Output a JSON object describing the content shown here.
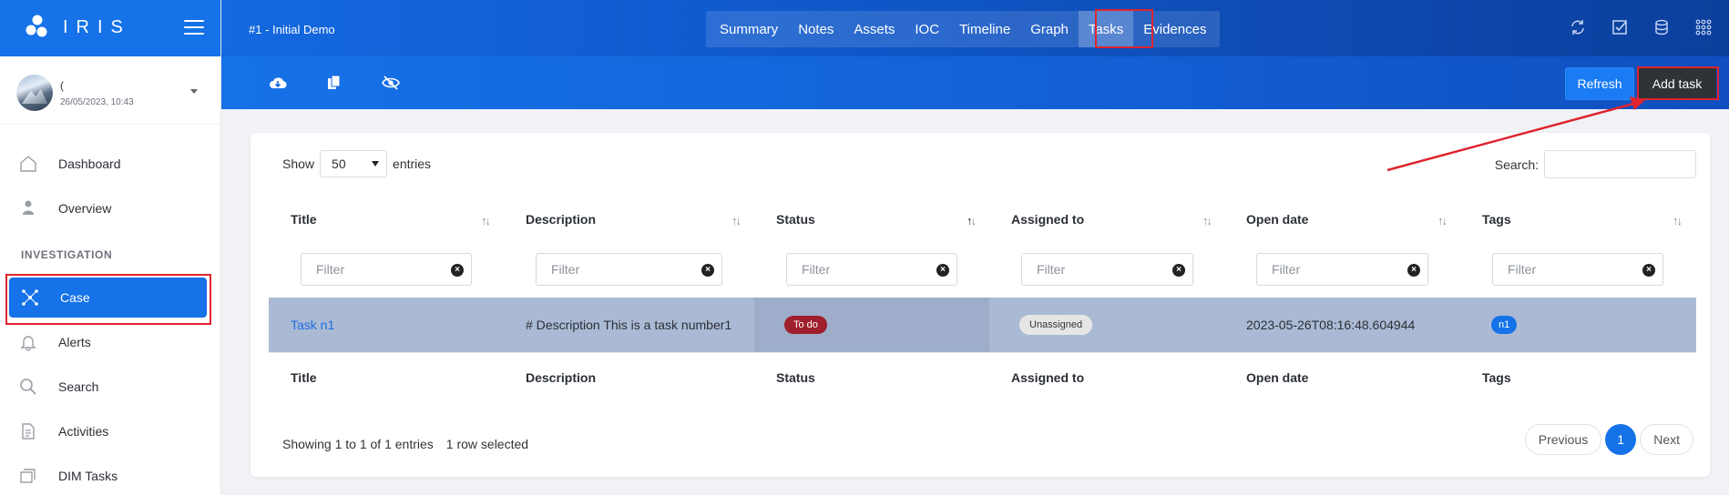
{
  "app": {
    "logo_text": "IRIS"
  },
  "user": {
    "name": "(",
    "date": "26/05/2023, 10:43"
  },
  "sidebar": {
    "section_label": "INVESTIGATION",
    "items": [
      {
        "label": "Dashboard",
        "icon": "home-icon"
      },
      {
        "label": "Overview",
        "icon": "user-pin-icon"
      },
      {
        "label": "Case",
        "icon": "network-icon"
      },
      {
        "label": "Alerts",
        "icon": "bell-icon"
      },
      {
        "label": "Search",
        "icon": "search-icon"
      },
      {
        "label": "Activities",
        "icon": "document-icon"
      },
      {
        "label": "DIM Tasks",
        "icon": "stack-icon"
      }
    ]
  },
  "header": {
    "case_title": "#1 - Initial Demo",
    "tabs": [
      "Summary",
      "Notes",
      "Assets",
      "IOC",
      "Timeline",
      "Graph",
      "Tasks",
      "Evidences"
    ],
    "active_tab": "Tasks"
  },
  "toolbar": {
    "refresh_label": "Refresh",
    "add_label": "Add task"
  },
  "table_controls": {
    "show_label": "Show",
    "entries_value": "50",
    "entries_label": "entries",
    "search_label": "Search:"
  },
  "table": {
    "headers": [
      "Title",
      "Description",
      "Status",
      "Assigned to",
      "Open date",
      "Tags"
    ],
    "filter_placeholder": "Filter",
    "rows": [
      {
        "title": "Task n1",
        "description": "# Description This is a task number1",
        "status": "To do",
        "assigned": "Unassigned",
        "open_date": "2023-05-26T08:16:48.604944",
        "tag": "n1"
      }
    ]
  },
  "footer": {
    "info": "Showing 1 to 1 of 1 entries",
    "selected": "1 row selected",
    "previous": "Previous",
    "page": "1",
    "next": "Next"
  },
  "colors": {
    "primary": "#1572e8",
    "highlight": "#e0242e",
    "selected_row": "#abbad4",
    "status_todo": "#a01f2c"
  }
}
